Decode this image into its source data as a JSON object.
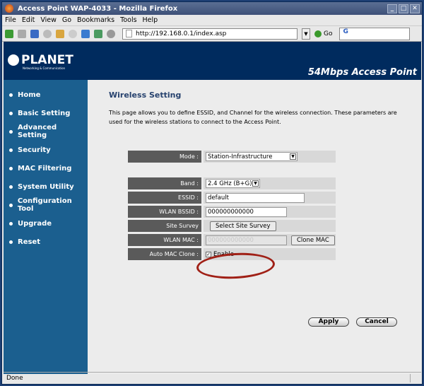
{
  "window": {
    "title": "Access Point WAP-4033 - Mozilla Firefox"
  },
  "menu": [
    "File",
    "Edit",
    "View",
    "Go",
    "Bookmarks",
    "Tools",
    "Help"
  ],
  "toolbar": {
    "url": "http://192.168.0.1/index.asp",
    "go_label": "Go"
  },
  "header": {
    "logo": "PLANET",
    "logo_sub": "Networking & Communication",
    "tagline": "54Mbps Access Point"
  },
  "sidebar": {
    "items": [
      "Home",
      "Basic Setting",
      "Advanced Setting",
      "Security",
      "MAC Filtering",
      "System Utility",
      "Configuration Tool",
      "Upgrade",
      "Reset"
    ]
  },
  "main": {
    "title": "Wireless Setting",
    "description": "This page allows you to define ESSID, and Channel for the wireless connection. These parameters are used for the wireless stations to connect to the Access Point.",
    "mode_label": "Mode :",
    "mode_value": "Station-Infrastructure",
    "band_label": "Band :",
    "band_value": "2.4 GHz (B+G)",
    "essid_label": "ESSID :",
    "essid_value": "default",
    "bssid_label": "WLAN BSSID :",
    "bssid_value": "000000000000",
    "survey_label": "Site Survey",
    "survey_button": "Select Site Survey",
    "mac_label": "WLAN MAC :",
    "mac_value": "000000000000",
    "clone_button": "Clone MAC",
    "clone_label": "Auto MAC Clone :",
    "clone_enable": "Enable",
    "clone_checked": true,
    "apply": "Apply",
    "cancel": "Cancel"
  },
  "status": "Done",
  "annotation_color": "#a02016"
}
